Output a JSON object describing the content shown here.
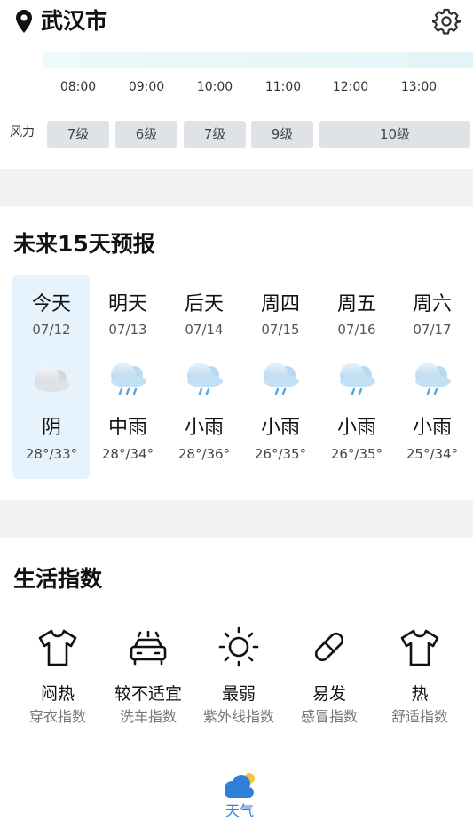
{
  "header": {
    "city": "武汉市"
  },
  "hourly": {
    "times": [
      "08:00",
      "09:00",
      "10:00",
      "11:00",
      "12:00",
      "13:00"
    ],
    "wind_label": "风力",
    "wind_levels": [
      "7级",
      "6级",
      "7级",
      "9级",
      "10级"
    ]
  },
  "forecast": {
    "title": "未来15天预报",
    "days": [
      {
        "name": "今天",
        "date": "07/12",
        "condition": "阴",
        "temp": "28°/33°",
        "icon": "overcast-cloud-icon"
      },
      {
        "name": "明天",
        "date": "07/13",
        "condition": "中雨",
        "temp": "28°/34°",
        "icon": "rain-cloud-icon"
      },
      {
        "name": "后天",
        "date": "07/14",
        "condition": "小雨",
        "temp": "28°/36°",
        "icon": "rain-cloud-icon"
      },
      {
        "name": "周四",
        "date": "07/15",
        "condition": "小雨",
        "temp": "26°/35°",
        "icon": "rain-cloud-icon"
      },
      {
        "name": "周五",
        "date": "07/16",
        "condition": "小雨",
        "temp": "26°/35°",
        "icon": "rain-cloud-icon"
      },
      {
        "name": "周六",
        "date": "07/17",
        "condition": "小雨",
        "temp": "25°/34°",
        "icon": "rain-cloud-icon"
      }
    ]
  },
  "life_index": {
    "title": "生活指数",
    "items": [
      {
        "value": "闷热",
        "name": "穿衣指数",
        "icon": "tshirt-icon"
      },
      {
        "value": "较不适宜",
        "name": "洗车指数",
        "icon": "car-icon"
      },
      {
        "value": "最弱",
        "name": "紫外线指数",
        "icon": "sun-icon"
      },
      {
        "value": "易发",
        "name": "感冒指数",
        "icon": "pill-icon"
      },
      {
        "value": "热",
        "name": "舒适指数",
        "icon": "tshirt-icon"
      }
    ]
  },
  "bottom_nav": {
    "label": "天气",
    "icon": "weather-cloud-icon"
  },
  "colors": {
    "accent": "#2f7fd8",
    "today_highlight": "#e6f3fd",
    "wind_box": "#dfe2e6",
    "separator": "#f2f2f3"
  }
}
